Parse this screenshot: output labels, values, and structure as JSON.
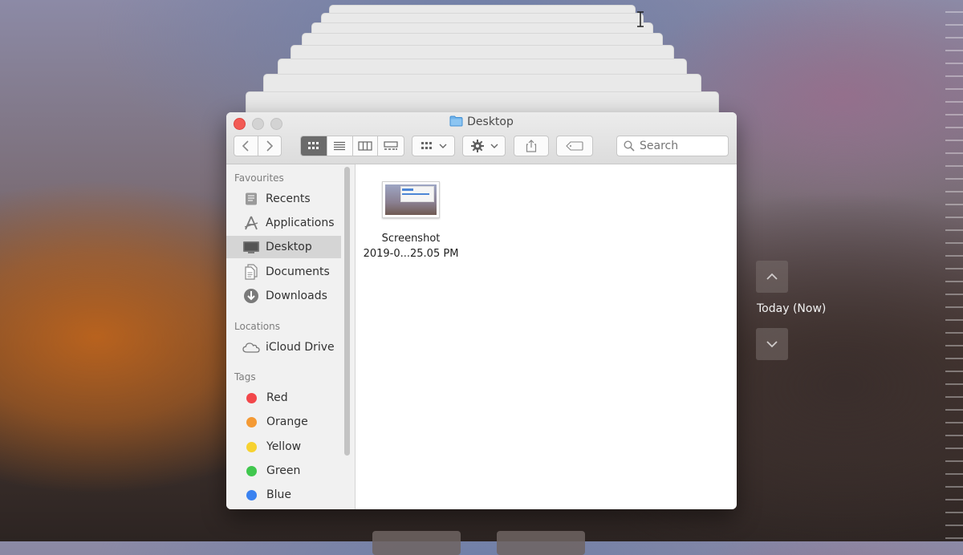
{
  "window": {
    "title": "Desktop",
    "nav": {
      "back_icon": "chevron-left-icon",
      "forward_icon": "chevron-right-icon"
    },
    "view_modes": [
      "icon-view-icon",
      "list-view-icon",
      "column-view-icon",
      "gallery-view-icon"
    ],
    "search": {
      "placeholder": "Search"
    }
  },
  "sidebar": {
    "favourites_label": "Favourites",
    "favourites": [
      {
        "label": "Recents",
        "icon": "recents-icon"
      },
      {
        "label": "Applications",
        "icon": "applications-icon"
      },
      {
        "label": "Desktop",
        "icon": "desktop-icon",
        "selected": true
      },
      {
        "label": "Documents",
        "icon": "documents-icon"
      },
      {
        "label": "Downloads",
        "icon": "downloads-icon"
      }
    ],
    "locations_label": "Locations",
    "locations": [
      {
        "label": "iCloud Drive",
        "icon": "cloud-icon"
      }
    ],
    "tags_label": "Tags",
    "tags": [
      {
        "label": "Red",
        "color": "#f2474a"
      },
      {
        "label": "Orange",
        "color": "#f49a34"
      },
      {
        "label": "Yellow",
        "color": "#f7d230"
      },
      {
        "label": "Green",
        "color": "#40c74e"
      },
      {
        "label": "Blue",
        "color": "#3a82f0"
      }
    ]
  },
  "files": [
    {
      "line1": "Screenshot",
      "line2": "2019-0...25.05 PM"
    }
  ],
  "time_machine": {
    "label": "Today (Now)"
  }
}
